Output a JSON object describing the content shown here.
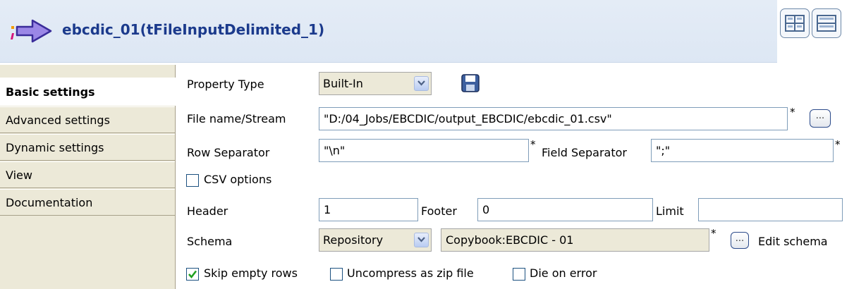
{
  "header": {
    "title": "ebcdic_01(tFileInputDelimited_1)",
    "component_icon": "file-input-delimited-icon",
    "layout_buttons": [
      "grid-layout-icon",
      "rows-layout-icon"
    ]
  },
  "sidebar": {
    "tabs": [
      {
        "label": "Basic settings",
        "active": true
      },
      {
        "label": "Advanced settings",
        "active": false
      },
      {
        "label": "Dynamic settings",
        "active": false
      },
      {
        "label": "View",
        "active": false
      },
      {
        "label": "Documentation",
        "active": false
      }
    ]
  },
  "form": {
    "property_type": {
      "label": "Property Type",
      "value": "Built-In",
      "save_icon": "floppy-disk-icon"
    },
    "file_name": {
      "label": "File name/Stream",
      "value": "\"D:/04_Jobs/EBCDIC/output_EBCDIC/ebcdic_01.csv\"",
      "required": "*",
      "browse_label": "..."
    },
    "row_separator": {
      "label": "Row Separator",
      "value": "\"\\n\"",
      "required": "*"
    },
    "field_separator": {
      "label": "Field Separator",
      "value": "\";\"",
      "required": "*"
    },
    "csv_options": {
      "label": "CSV options",
      "checked": false
    },
    "header": {
      "label": "Header",
      "value": "1"
    },
    "footer": {
      "label": "Footer",
      "value": "0"
    },
    "limit": {
      "label": "Limit",
      "value": ""
    },
    "schema": {
      "label": "Schema",
      "type_value": "Repository",
      "repo_value": "Copybook:EBCDIC - 01",
      "required": "*",
      "browse_label": "...",
      "edit_label": "Edit schema"
    },
    "skip_empty_rows": {
      "label": "Skip empty rows",
      "checked": true
    },
    "uncompress_zip": {
      "label": "Uncompress as zip file",
      "checked": false
    },
    "die_on_error": {
      "label": "Die on error",
      "checked": false
    }
  },
  "colors": {
    "title": "#1b3a8c",
    "header_band": "#dde7f4",
    "panel_bg": "#ece9d8",
    "check_green": "#21a121"
  }
}
